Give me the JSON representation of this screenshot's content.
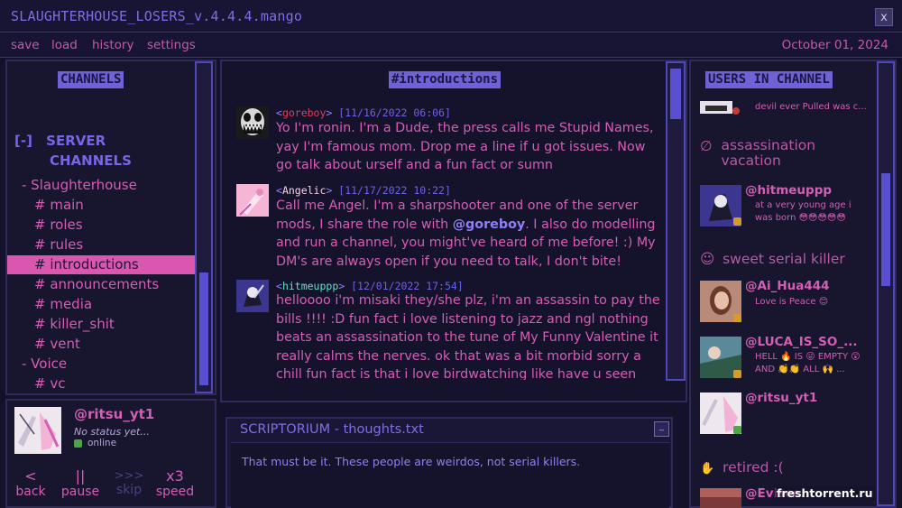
{
  "window": {
    "title": "SLAUGHTERHOUSE_LOSERS_v.4.4.4.mango",
    "close_label": "x"
  },
  "menu": {
    "items": [
      "save",
      "load",
      "history",
      "settings"
    ],
    "date": "October 01, 2024"
  },
  "channels": {
    "header": "CHANNELS",
    "toggle": "[-]",
    "server_title_1": "SERVER",
    "server_title_2": "CHANNELS",
    "server_name": "- Slaughterhouse",
    "list": [
      "# main",
      "# roles",
      "# rules",
      "# introductions",
      "# announcements",
      "# media",
      "# killer_shit",
      "# vent"
    ],
    "voice_name": "- Voice",
    "voice_list": [
      "# vc"
    ]
  },
  "profile": {
    "name": "@ritsu_yt1",
    "status": "No status yet...",
    "online": "online"
  },
  "controls": {
    "back": {
      "sym": "<",
      "label": "back"
    },
    "pause": {
      "sym": "||",
      "label": "pause"
    },
    "skip": {
      "sym": ">>>",
      "label": "skip"
    },
    "speed": {
      "sym": "x3",
      "label": "speed"
    }
  },
  "chat": {
    "channel": "#introductions",
    "messages": [
      {
        "user": "goreboy",
        "timestamp": "[11/16/2022 06:06]",
        "text": "Yo I'm ronin. I'm a Dude, the press calls me Stupid Names, yay I'm famous mom. Drop me a line if u got issues. Now go talk about urself and a fun fact or sumn"
      },
      {
        "user": "Angelic",
        "timestamp": "[11/17/2022 10:22]",
        "text_before": "Call me Angel. I'm a sharpshooter and one of the server mods, I share the role with ",
        "mention": "@goreboy",
        "text_after": ". I also do modelling and run a channel, you might've heard of me before! :) My DM's are always open if you need to talk, I don't bite!"
      },
      {
        "user": "hitmeuppp",
        "timestamp": "[12/01/2022 17:54]",
        "text": "helloooo i'm misaki they/she plz, i'm an assassin to pay the bills !!!! :D fun fact i love listening to jazz and ngl nothing beats an assassination to the tune of My Funny Valentine it really calms the nerves. ok that was a bit morbid sorry a chill fun fact is that i love birdwatching like have u seen"
      }
    ]
  },
  "scriptorium": {
    "title": "SCRIPTORIUM - thoughts.txt",
    "minimize": "_",
    "text": "That must be it. These people are weirdos, not serial killers."
  },
  "users": {
    "header": "USERS IN CHANNEL",
    "top_status": "devil ever Pulled was c...",
    "groups": [
      {
        "label": "assassination vacation",
        "icon": "∅"
      },
      {
        "label": "sweet serial killer",
        "icon": "☺"
      },
      {
        "label": "retired :(",
        "icon": "✋"
      }
    ],
    "members": [
      {
        "name": "@hitmeuppp",
        "status": "at a very young age i was born 😳😳😳😳😳"
      },
      {
        "name": "@Ai_Hua444",
        "status": "Love is Peace 😊"
      },
      {
        "name": "@LUCA_IS_SO_...",
        "status": "HELL 🔥 IS 😜 EMPTY 😲 AND 👏👏 ALL 🙌 ..."
      },
      {
        "name": "@ritsu_yt1",
        "status": ""
      },
      {
        "name": "@Evisce...",
        "status": ""
      }
    ]
  },
  "watermark": "freshtorrent.ru",
  "colors": {
    "accent": "#6e62d6",
    "pink": "#d35fb4",
    "bg": "#14112a"
  }
}
